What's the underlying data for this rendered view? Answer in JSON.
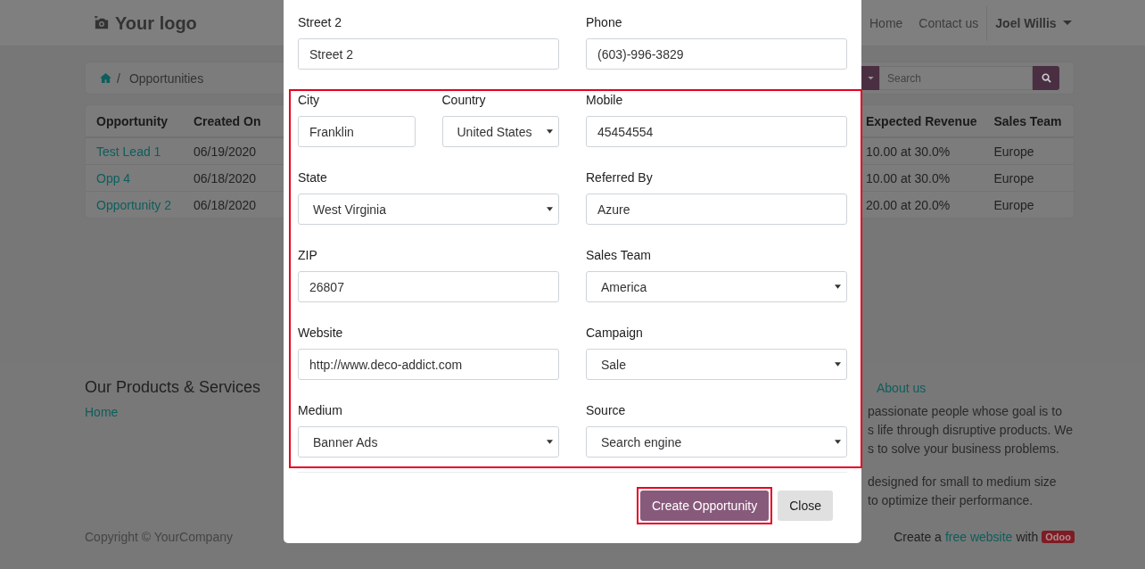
{
  "header": {
    "logo": "Your logo",
    "nav": [
      "Home",
      "Contact us"
    ],
    "user": "Joel Willis"
  },
  "breadcrumb": {
    "separator": "/",
    "current": "Opportunities"
  },
  "search": {
    "placeholder": "Search"
  },
  "table": {
    "columns_left": [
      "Opportunity",
      "Created On"
    ],
    "columns_right": [
      "Expected Revenue",
      "Sales Team"
    ],
    "rows": [
      {
        "opportunity": "Test Lead 1",
        "created_on": "06/19/2020",
        "expected_revenue": "10.00 at 30.0%",
        "sales_team": "Europe"
      },
      {
        "opportunity": "Opp 4",
        "created_on": "06/18/2020",
        "expected_revenue": "10.00 at 30.0%",
        "sales_team": "Europe"
      },
      {
        "opportunity": "Opportunity 2",
        "created_on": "06/18/2020",
        "expected_revenue": "20.00 at 20.0%",
        "sales_team": "Europe"
      }
    ]
  },
  "footer": {
    "left_title": "Our Products & Services",
    "left_link": "Home",
    "right_link": "About us",
    "right_lines": [
      "passionate people whose goal is to",
      "s life through disruptive products. We",
      "s to solve your business problems."
    ],
    "right_lines_2": [
      "designed for small to medium size",
      "to optimize their performance."
    ],
    "copyright": "Copyright © YourCompany",
    "credit_prefix": "Create a",
    "credit_link": "free website",
    "credit_suffix": "with",
    "credit_badge": "Odoo"
  },
  "modal": {
    "sections": [
      {
        "highlighted": false,
        "rows": [
          {
            "left": [
              {
                "label": "Street 2",
                "value": "Street 2",
                "kind": "input"
              }
            ],
            "right": {
              "label": "Phone",
              "value": "(603)-996-3829",
              "kind": "input"
            }
          }
        ]
      },
      {
        "highlighted": true,
        "rows": [
          {
            "left": [
              {
                "label": "City",
                "value": "Franklin",
                "kind": "input"
              },
              {
                "label": "Country",
                "value": "United States",
                "kind": "select"
              }
            ],
            "right": {
              "label": "Mobile",
              "value": "45454554",
              "kind": "input"
            }
          },
          {
            "left": [
              {
                "label": "State",
                "value": "West Virginia",
                "kind": "select"
              }
            ],
            "right": {
              "label": "Referred By",
              "value": "Azure",
              "kind": "input"
            }
          },
          {
            "left": [
              {
                "label": "ZIP",
                "value": "26807",
                "kind": "input"
              }
            ],
            "right": {
              "label": "Sales Team",
              "value": "America",
              "kind": "select"
            }
          },
          {
            "left": [
              {
                "label": "Website",
                "value": "http://www.deco-addict.com",
                "kind": "input"
              }
            ],
            "right": {
              "label": "Campaign",
              "value": "Sale",
              "kind": "select"
            }
          },
          {
            "left": [
              {
                "label": "Medium",
                "value": "Banner Ads",
                "kind": "select"
              }
            ],
            "right": {
              "label": "Source",
              "value": "Search engine",
              "kind": "select"
            }
          }
        ]
      }
    ],
    "buttons": [
      {
        "label": "Create Opportunity",
        "kind": "primary",
        "highlighted": true
      },
      {
        "label": "Close",
        "kind": "secondary",
        "highlighted": false
      }
    ]
  }
}
